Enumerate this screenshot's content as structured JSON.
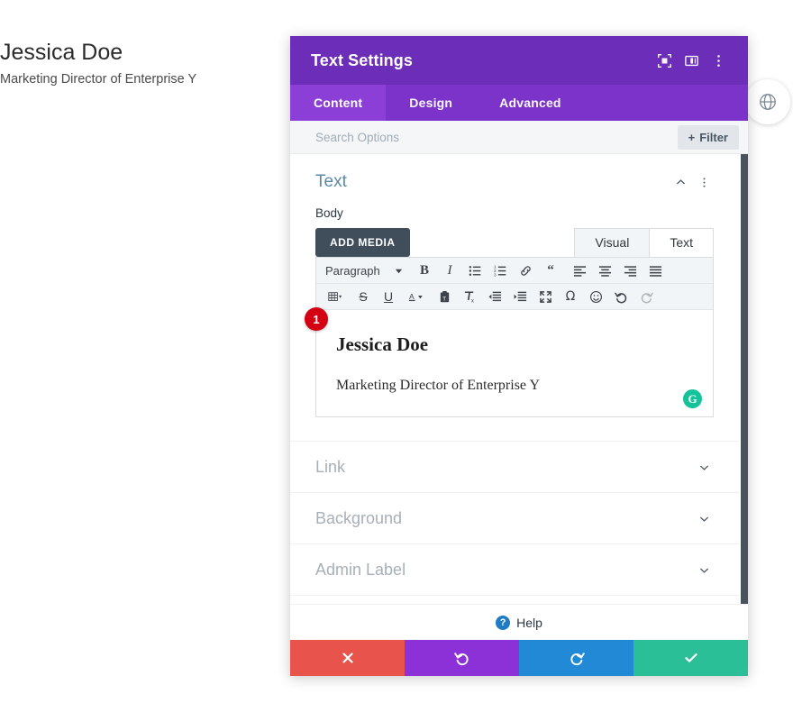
{
  "page": {
    "title": "Jessica Doe",
    "subtitle": "Marketing Director of Enterprise Y",
    "globe_icon": "globe-icon"
  },
  "modal": {
    "title": "Text Settings",
    "header_icons": [
      {
        "name": "focus-target-icon",
        "label": "Focus"
      },
      {
        "name": "panel-layout-icon",
        "label": "Layout"
      },
      {
        "name": "more-vertical-icon",
        "label": "More"
      }
    ],
    "tabs": [
      {
        "label": "Content",
        "active": true
      },
      {
        "label": "Design",
        "active": false
      },
      {
        "label": "Advanced",
        "active": false
      }
    ],
    "search": {
      "placeholder": "Search Options",
      "value": "",
      "filter_label": "Filter",
      "filter_icon": "plus-icon"
    },
    "sections": {
      "open": {
        "title": "Text",
        "collapse_icon": "chevron-up-icon",
        "menu_icon": "more-vertical-icon",
        "field_label": "Body",
        "add_media_label": "ADD MEDIA",
        "editor_tabs": [
          {
            "label": "Visual",
            "active": true
          },
          {
            "label": "Text",
            "active": false
          }
        ],
        "toolbar_row1": [
          {
            "name": "paragraph-format-select",
            "label": "Paragraph",
            "type": "select"
          },
          {
            "name": "bold-icon",
            "label": "B",
            "type": "icon"
          },
          {
            "name": "italic-icon",
            "label": "I",
            "type": "icon"
          },
          {
            "name": "bulleted-list-icon",
            "label": "Bulleted list",
            "type": "icon"
          },
          {
            "name": "numbered-list-icon",
            "label": "Numbered list",
            "type": "icon"
          },
          {
            "name": "link-icon",
            "label": "Insert link",
            "type": "icon"
          },
          {
            "name": "blockquote-icon",
            "label": "Blockquote",
            "type": "icon"
          },
          {
            "name": "align-left-icon",
            "label": "Align left",
            "type": "icon"
          },
          {
            "name": "align-center-icon",
            "label": "Align center",
            "type": "icon"
          },
          {
            "name": "align-right-icon",
            "label": "Align right",
            "type": "icon"
          },
          {
            "name": "align-justify-icon",
            "label": "Justify",
            "type": "icon"
          }
        ],
        "toolbar_row2": [
          {
            "name": "table-icon",
            "label": "Table",
            "type": "icon"
          },
          {
            "name": "strikethrough-icon",
            "label": "S",
            "type": "icon"
          },
          {
            "name": "underline-icon",
            "label": "U",
            "type": "icon"
          },
          {
            "name": "text-color-icon",
            "label": "A",
            "type": "icon"
          },
          {
            "name": "paste-as-text-icon",
            "label": "Paste as text",
            "type": "icon"
          },
          {
            "name": "clear-formatting-icon",
            "label": "Clear formatting",
            "type": "icon"
          },
          {
            "name": "outdent-icon",
            "label": "Decrease indent",
            "type": "icon"
          },
          {
            "name": "indent-icon",
            "label": "Increase indent",
            "type": "icon"
          },
          {
            "name": "fullscreen-icon",
            "label": "Fullscreen",
            "type": "icon"
          },
          {
            "name": "special-character-icon",
            "label": "Ω",
            "type": "icon"
          },
          {
            "name": "emoji-icon",
            "label": "Emoji",
            "type": "icon"
          },
          {
            "name": "undo-icon",
            "label": "Undo",
            "type": "icon"
          },
          {
            "name": "redo-icon",
            "label": "Redo",
            "type": "icon",
            "disabled": true
          }
        ],
        "content_heading": "Jessica Doe",
        "content_paragraph": "Marketing Director of Enterprise Y",
        "grammarly_letter": "G"
      },
      "collapsed": [
        {
          "title": "Link",
          "icon": "chevron-down-icon"
        },
        {
          "title": "Background",
          "icon": "chevron-down-icon"
        },
        {
          "title": "Admin Label",
          "icon": "chevron-down-icon"
        }
      ]
    },
    "help": {
      "label": "Help",
      "mark": "?"
    },
    "actions": [
      {
        "name": "cancel-button",
        "icon": "close-x-icon",
        "color": "#e8544b"
      },
      {
        "name": "undo-button",
        "icon": "undo-arrow-icon",
        "color": "#8c30d8"
      },
      {
        "name": "redo-button",
        "icon": "redo-arrow-icon",
        "color": "#2189d6"
      },
      {
        "name": "save-button",
        "icon": "checkmark-icon",
        "color": "#2bbf98"
      }
    ]
  },
  "annotation": {
    "step_number": "1"
  }
}
